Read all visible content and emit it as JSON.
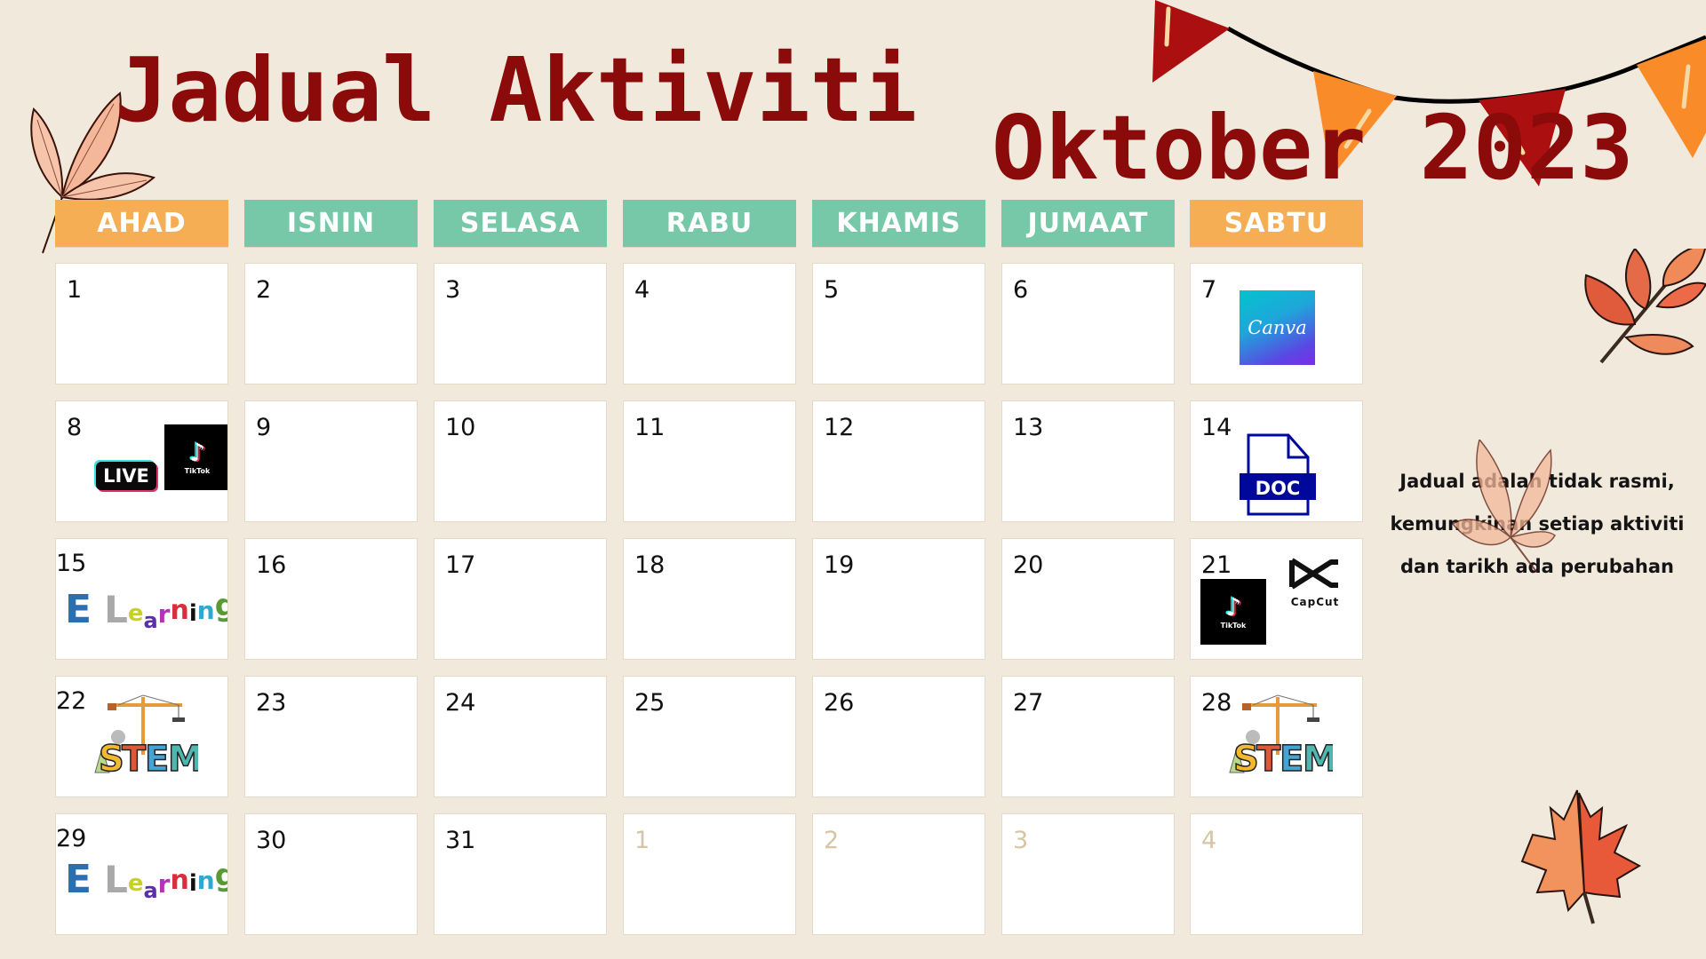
{
  "title": {
    "main": "Jadual Aktiviti",
    "month": "Oktober 2023"
  },
  "colors": {
    "title": "#8b0a0a",
    "weekend_header": "#f6ae55",
    "weekday_header": "#76c8a8",
    "background": "#f1e9dc",
    "muted_day": "#d7c4a4"
  },
  "calendar": {
    "headers": [
      {
        "label": "AHAD",
        "type": "weekend"
      },
      {
        "label": "ISNIN",
        "type": "weekday"
      },
      {
        "label": "SELASA",
        "type": "weekday"
      },
      {
        "label": "RABU",
        "type": "weekday"
      },
      {
        "label": "KHAMIS",
        "type": "weekday"
      },
      {
        "label": "JUMAAT",
        "type": "weekday"
      },
      {
        "label": "SABTU",
        "type": "weekend"
      }
    ],
    "weeks": [
      [
        {
          "day": "1"
        },
        {
          "day": "2"
        },
        {
          "day": "3"
        },
        {
          "day": "4"
        },
        {
          "day": "5"
        },
        {
          "day": "6"
        },
        {
          "day": "7",
          "activities": [
            {
              "icon": "canva-icon",
              "label": "Canva"
            }
          ]
        }
      ],
      [
        {
          "day": "8",
          "activities": [
            {
              "icon": "live-badge-icon",
              "label": "LIVE"
            },
            {
              "icon": "tiktok-icon",
              "label": "TikTok"
            }
          ]
        },
        {
          "day": "9"
        },
        {
          "day": "10"
        },
        {
          "day": "11"
        },
        {
          "day": "12"
        },
        {
          "day": "13"
        },
        {
          "day": "14",
          "activities": [
            {
              "icon": "doc-file-icon",
              "label": "DOC"
            }
          ]
        }
      ],
      [
        {
          "day": "15",
          "activities": [
            {
              "icon": "e-learning-icon",
              "label": "E Learning"
            }
          ]
        },
        {
          "day": "16"
        },
        {
          "day": "17"
        },
        {
          "day": "18"
        },
        {
          "day": "19"
        },
        {
          "day": "20"
        },
        {
          "day": "21",
          "activities": [
            {
              "icon": "tiktok-icon",
              "label": "TikTok"
            },
            {
              "icon": "capcut-icon",
              "label": "CapCut"
            }
          ]
        }
      ],
      [
        {
          "day": "22",
          "activities": [
            {
              "icon": "stem-icon",
              "label": "STEM"
            }
          ]
        },
        {
          "day": "23"
        },
        {
          "day": "24"
        },
        {
          "day": "25"
        },
        {
          "day": "26"
        },
        {
          "day": "27"
        },
        {
          "day": "28",
          "activities": [
            {
              "icon": "stem-icon",
              "label": "STEM"
            }
          ]
        }
      ],
      [
        {
          "day": "29",
          "activities": [
            {
              "icon": "e-learning-icon",
              "label": "E Learning"
            }
          ]
        },
        {
          "day": "30"
        },
        {
          "day": "31"
        },
        {
          "day": "1",
          "muted": true
        },
        {
          "day": "2",
          "muted": true
        },
        {
          "day": "3",
          "muted": true
        },
        {
          "day": "4",
          "muted": true
        }
      ]
    ]
  },
  "note": {
    "lines": [
      "Jadual adalah tidak rasmi,",
      "kemungkinan setiap aktiviti",
      "dan tarikh ada perubahan"
    ]
  },
  "icons": {
    "canva_text": "Canva",
    "live_text": "LIVE",
    "tiktok_text": "TikTok",
    "tiktok_glyph": "♪",
    "doc_text": "DOC",
    "capcut_text": "CapCut",
    "elearning_letters": [
      "E",
      " ",
      "L",
      "e",
      "a",
      "r",
      "n",
      "i",
      "n",
      "g"
    ],
    "stem_letters": [
      "S",
      "T",
      "E",
      "M"
    ]
  }
}
